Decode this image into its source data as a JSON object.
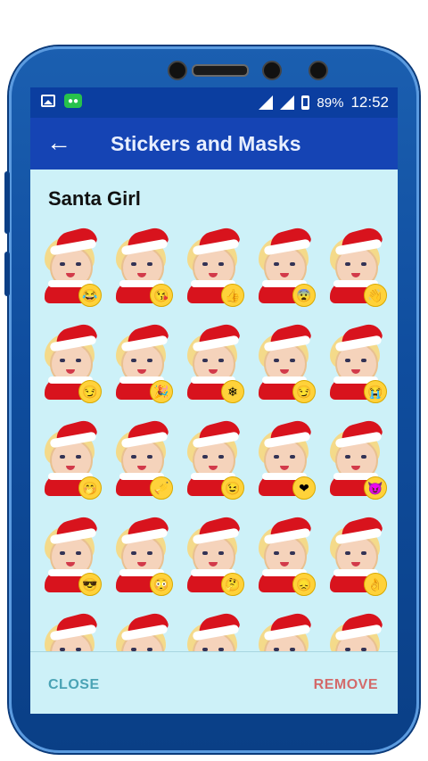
{
  "status_bar": {
    "battery": "89%",
    "time": "12:52",
    "left_icons": [
      "image-icon",
      "chat-app-icon"
    ],
    "right_icons": [
      "signal-icon",
      "signal-icon",
      "battery-icon"
    ]
  },
  "app_bar": {
    "title": "Stickers and Masks",
    "back_icon": "arrow-back-icon"
  },
  "pack": {
    "name": "Santa Girl"
  },
  "stickers": [
    {
      "emoji": "😂"
    },
    {
      "emoji": "😘"
    },
    {
      "emoji": "👍"
    },
    {
      "emoji": "😨"
    },
    {
      "emoji": "👋"
    },
    {
      "emoji": "😏"
    },
    {
      "emoji": "🎉"
    },
    {
      "emoji": "❄"
    },
    {
      "emoji": "😏"
    },
    {
      "emoji": "😭"
    },
    {
      "emoji": "🤭"
    },
    {
      "emoji": "🎺"
    },
    {
      "emoji": "😉"
    },
    {
      "emoji": "❤"
    },
    {
      "emoji": "😈"
    },
    {
      "emoji": "😎"
    },
    {
      "emoji": "😳"
    },
    {
      "emoji": "🤔"
    },
    {
      "emoji": "😞"
    },
    {
      "emoji": "👌"
    },
    {
      "emoji": ""
    },
    {
      "emoji": ""
    },
    {
      "emoji": ""
    },
    {
      "emoji": ""
    },
    {
      "emoji": ""
    }
  ],
  "bottom_bar": {
    "close_label": "CLOSE",
    "remove_label": "REMOVE"
  },
  "colors": {
    "status_bar": "#0b3ea0",
    "app_bar": "#1544b4",
    "screen_bg": "#cdf1f8",
    "close": "#4aa3b5",
    "remove": "#d36a6a"
  }
}
